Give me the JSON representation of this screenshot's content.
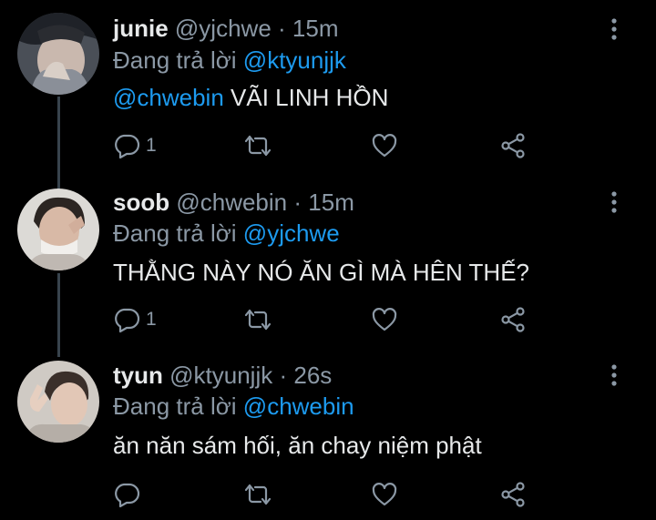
{
  "colors": {
    "background": "#000000",
    "primary_text": "#e7e9ea",
    "secondary_text": "#8b98a5",
    "link": "#1d9bf0",
    "thread_line": "#38444d"
  },
  "tweets": [
    {
      "name": "junie",
      "handle": "@yjchwe",
      "separator": "·",
      "time": "15m",
      "reply_prefix": "Đang trả lời",
      "reply_to": "@ktyunjjk",
      "content_mention": "@chwebin",
      "content_text": " VÃI LINH HỒN",
      "reply_count": "1",
      "icons": [
        "reply-icon",
        "retweet-icon",
        "like-icon",
        "share-icon",
        "more-icon"
      ]
    },
    {
      "name": "soob",
      "handle": "@chwebin",
      "separator": "·",
      "time": "15m",
      "reply_prefix": "Đang trả lời",
      "reply_to": "@yjchwe",
      "content_text": "THẰNG NÀY NÓ ĂN GÌ MÀ HÊN THẾ?",
      "reply_count": "1",
      "icons": [
        "reply-icon",
        "retweet-icon",
        "like-icon",
        "share-icon",
        "more-icon"
      ]
    },
    {
      "name": "tyun",
      "handle": "@ktyunjjk",
      "separator": "·",
      "time": "26s",
      "reply_prefix": "Đang trả lời",
      "reply_to": "@chwebin",
      "content_text": "ăn năn sám hối, ăn chay niệm phật",
      "icons": [
        "reply-icon",
        "retweet-icon",
        "like-icon",
        "share-icon",
        "more-icon"
      ]
    }
  ]
}
